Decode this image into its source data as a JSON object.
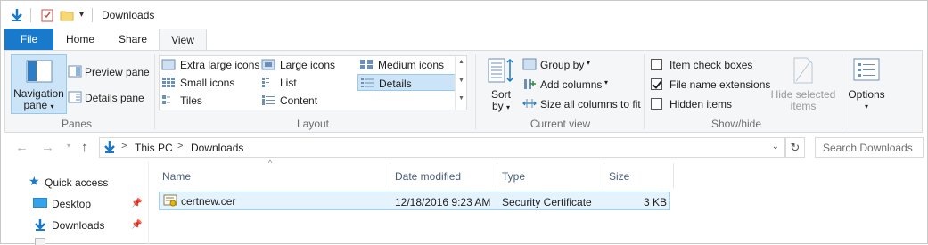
{
  "window": {
    "title": "Downloads"
  },
  "tabs": [
    {
      "label": "File"
    },
    {
      "label": "Home"
    },
    {
      "label": "Share"
    },
    {
      "label": "View"
    }
  ],
  "ribbon": {
    "panes": {
      "group_label": "Panes",
      "navigation_pane_line1": "Navigation",
      "navigation_pane_line2": "pane",
      "preview_pane": "Preview pane",
      "details_pane": "Details pane"
    },
    "layout": {
      "group_label": "Layout",
      "options": [
        {
          "label": "Extra large icons",
          "selected": false
        },
        {
          "label": "Large icons",
          "selected": false
        },
        {
          "label": "Medium icons",
          "selected": false
        },
        {
          "label": "Small icons",
          "selected": false
        },
        {
          "label": "List",
          "selected": false
        },
        {
          "label": "Details",
          "selected": true
        },
        {
          "label": "Tiles",
          "selected": false
        },
        {
          "label": "Content",
          "selected": false
        }
      ]
    },
    "current_view": {
      "group_label": "Current view",
      "sort_by_line1": "Sort",
      "sort_by_line2": "by",
      "group_by": "Group by",
      "add_columns": "Add columns",
      "size_all_columns": "Size all columns to fit"
    },
    "show_hide": {
      "group_label": "Show/hide",
      "item_check_boxes": {
        "label": "Item check boxes",
        "checked": false
      },
      "file_name_extensions": {
        "label": "File name extensions",
        "checked": true
      },
      "hidden_items": {
        "label": "Hidden items",
        "checked": false
      },
      "hide_selected_line1": "Hide selected",
      "hide_selected_line2": "items"
    },
    "options": {
      "label": "Options"
    }
  },
  "address": {
    "crumbs": [
      "This PC",
      "Downloads"
    ],
    "search_placeholder": "Search Downloads"
  },
  "nav": {
    "items": [
      {
        "label": "Quick access"
      },
      {
        "label": "Desktop"
      },
      {
        "label": "Downloads"
      }
    ]
  },
  "columns": [
    {
      "label": "Name"
    },
    {
      "label": "Date modified"
    },
    {
      "label": "Type"
    },
    {
      "label": "Size"
    }
  ],
  "files": [
    {
      "name": "certnew.cer",
      "date": "12/18/2016 9:23 AM",
      "type": "Security Certificate",
      "size": "3 KB"
    }
  ],
  "colors": {
    "accent": "#1979ca",
    "selection": "#cce4f7",
    "row_hover": "#e5f3ff"
  }
}
